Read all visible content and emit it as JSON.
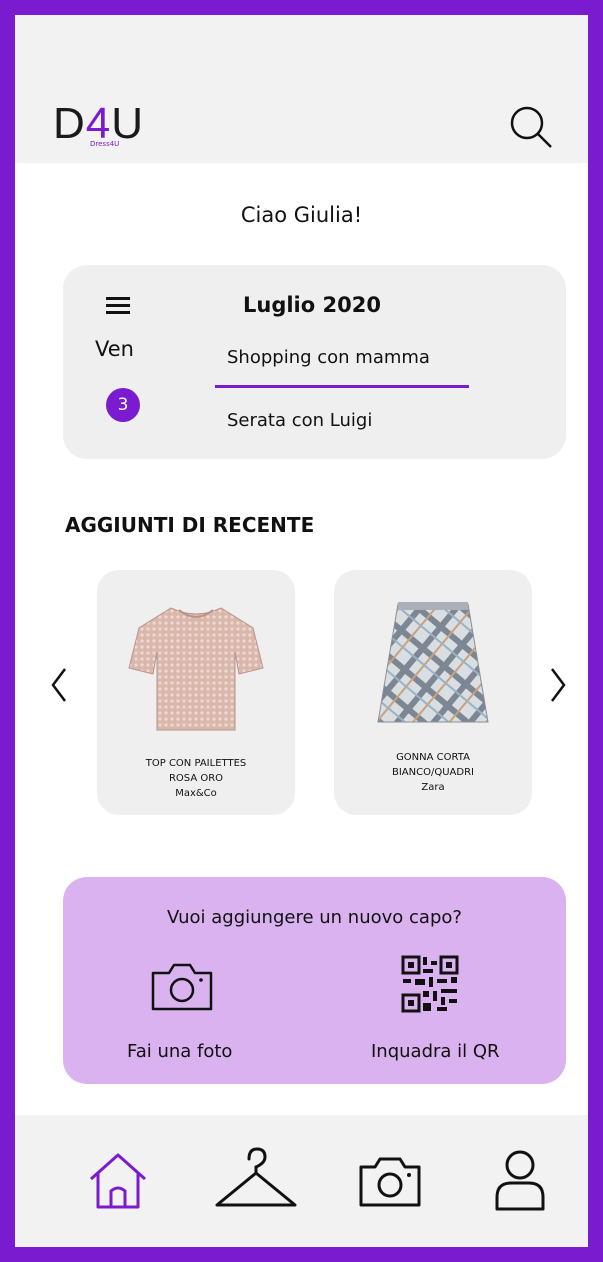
{
  "header": {
    "logo_prefix": "D",
    "logo_four": "4",
    "logo_suffix": "U",
    "logo_sub": "Dress4U"
  },
  "greeting": "Ciao Giulia!",
  "calendar": {
    "day": "Ven",
    "date": "3",
    "month": "Luglio 2020",
    "events": [
      "Shopping  con mamma",
      "Serata con Luigi"
    ]
  },
  "recent": {
    "title": "AGGIUNTI DI RECENTE",
    "items": [
      {
        "line1": "TOP CON PAILETTES",
        "line2": "ROSA ORO",
        "brand": "Max&Co"
      },
      {
        "line1": "GONNA CORTA",
        "line2": "BIANCO/QUADRI",
        "brand": "Zara"
      }
    ]
  },
  "add": {
    "title": "Vuoi aggiungere un nuovo capo?",
    "photo_label": "Fai una foto",
    "qr_label": "Inquadra il QR"
  },
  "nav": {
    "items": [
      "home-icon",
      "hanger-icon",
      "camera-icon",
      "user-icon"
    ],
    "active": "home-icon"
  },
  "colors": {
    "accent": "#7A1BD0",
    "add_box": "#d9b2ef",
    "card_bg": "#efefef"
  }
}
